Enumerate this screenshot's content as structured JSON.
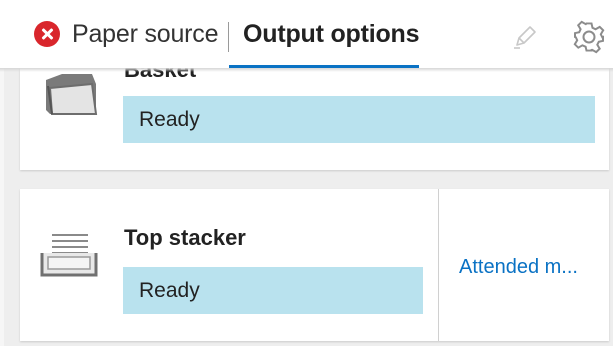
{
  "tabs": {
    "paper_source": {
      "label": "Paper source",
      "status_icon": "error-icon",
      "status_color": "#d9262c"
    },
    "output_options": {
      "label": "Output options",
      "selected": true,
      "accent_color": "#0a72c4"
    }
  },
  "toolbar": {
    "pen_icon": "pen-icon",
    "gear_icon": "gear-icon"
  },
  "outputs": {
    "basket": {
      "name": "Basket",
      "status": "Ready",
      "status_color": "#b9e2ee"
    },
    "top_stacker": {
      "name": "Top stacker",
      "status": "Ready",
      "status_color": "#b9e2ee",
      "link": "Attended m..."
    }
  }
}
